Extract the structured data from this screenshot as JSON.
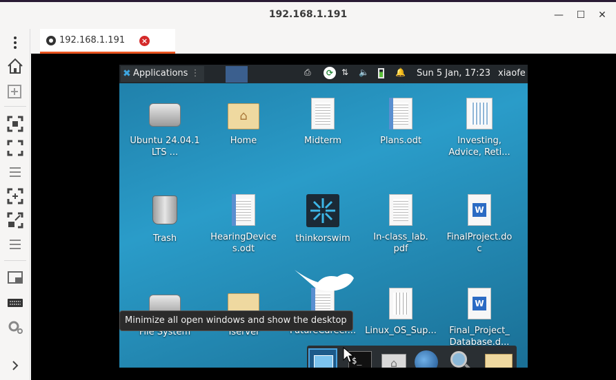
{
  "window": {
    "title": "192.168.1.191"
  },
  "tab": {
    "label": "192.168.1.191",
    "close": "×"
  },
  "remote": {
    "panel": {
      "applications_label": "Applications",
      "clock": "Sun  5 Jan, 17:23",
      "user": "xiaofe"
    },
    "desktop_icons": [
      {
        "label": "Ubuntu 24.04.1 LTS ...",
        "icon": "drive-icon"
      },
      {
        "label": "Home",
        "icon": "home-folder-icon"
      },
      {
        "label": "Midterm",
        "icon": "document-icon"
      },
      {
        "label": "Plans.odt",
        "icon": "writer-document-icon"
      },
      {
        "label": "Investing, Advice, Reti...",
        "icon": "spreadsheet-thumbnail-icon"
      },
      {
        "label": "Trash",
        "icon": "trash-icon"
      },
      {
        "label": "HearingDevices.odt",
        "icon": "writer-document-icon"
      },
      {
        "label": "thinkorswim",
        "icon": "thinkorswim-app-icon"
      },
      {
        "label": "In-class_lab.pdf",
        "icon": "pdf-icon"
      },
      {
        "label": "FinalProject.doc",
        "icon": "word-document-icon"
      },
      {
        "label": "File System",
        "icon": "drive-icon"
      },
      {
        "label": "Tserver",
        "icon": "folder-icon"
      },
      {
        "label": "FutureCareer...",
        "icon": "document-icon"
      },
      {
        "label": "Linux_OS_Sup...",
        "icon": "pdf-icon"
      },
      {
        "label": "Final_Project_ Database.d...",
        "icon": "word-document-icon"
      }
    ],
    "tooltip": "Minimize all open windows and show the desktop",
    "dock_items": [
      "show-desktop-icon",
      "terminal-icon",
      "home-folder-icon",
      "web-browser-icon",
      "search-icon",
      "folder-icon"
    ],
    "terminal_prompt": "$_"
  },
  "colors": {
    "accent": "#e95420",
    "close_badge": "#d42a2a",
    "desktop": "#2a9cc9"
  }
}
